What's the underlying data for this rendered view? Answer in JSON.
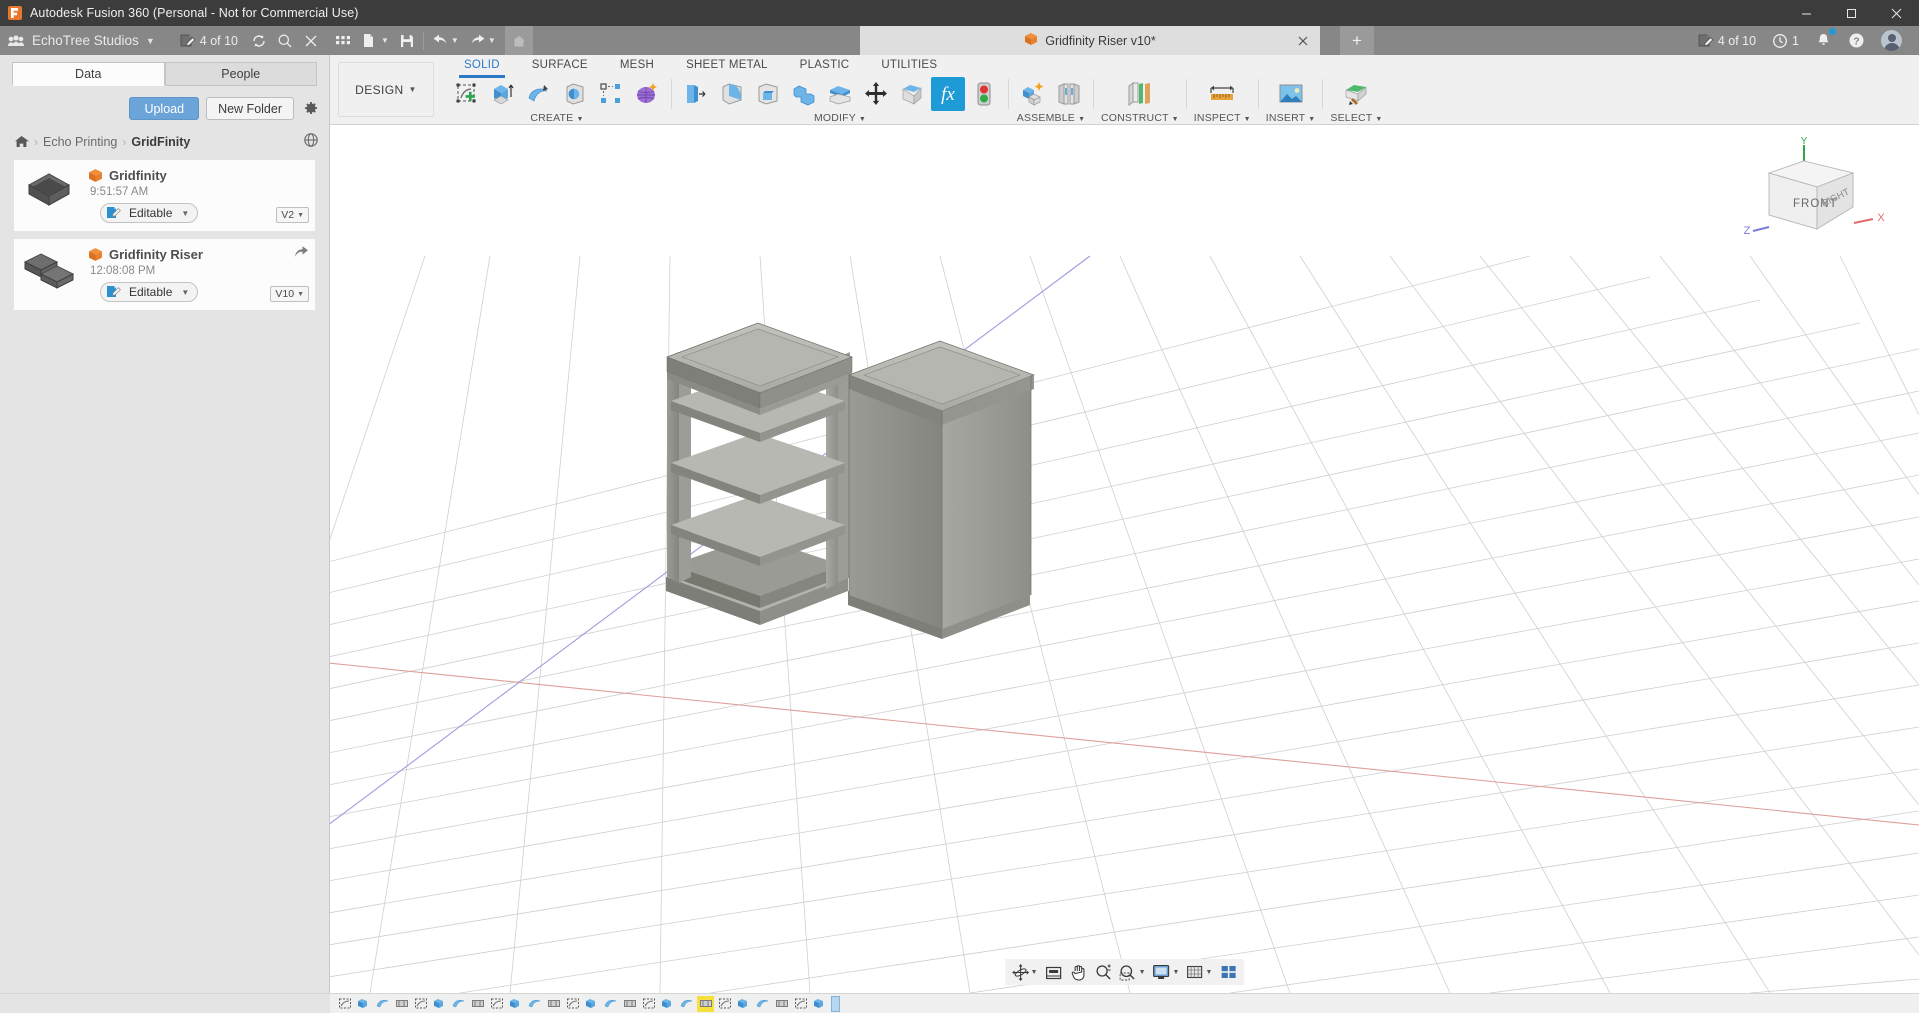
{
  "titlebar": {
    "app_title": "Autodesk Fusion 360 (Personal - Not for Commercial Use)",
    "logo_icon": "fusion-logo-icon",
    "minimize_icon": "minimize-icon",
    "maximize_icon": "maximize-icon",
    "close_icon": "close-icon"
  },
  "appbar": {
    "apps_grid_icon": "apps-grid-icon",
    "team_name": "EchoTree Studios",
    "team_caret_icon": "chevron-down-icon",
    "jobs_icon": "jobs-status-icon",
    "jobs_label": "4 of 10",
    "refresh_icon": "refresh-icon",
    "search_icon": "search-icon",
    "close_panel_icon": "close-icon",
    "quick_access": [
      {
        "name": "grid-menu-icon",
        "label": ""
      },
      {
        "name": "new-document-icon",
        "label": ""
      },
      {
        "name": "save-icon",
        "label": ""
      },
      {
        "name": "undo-icon",
        "label": ""
      },
      {
        "name": "redo-icon",
        "label": ""
      },
      {
        "name": "home-icon",
        "label": ""
      }
    ],
    "document_tab": {
      "cube_icon": "orange-cube-icon",
      "label": "Gridfinity Riser v10*",
      "close_icon": "close-icon"
    },
    "new_tab_icon": "plus-icon",
    "right": {
      "jobs_icon": "jobs-status-icon",
      "jobs_label": "4 of 10",
      "clock_icon": "clock-icon",
      "clock_label": "1",
      "bell_icon": "notification-bell-icon",
      "help_icon": "help-icon",
      "avatar_icon": "user-avatar"
    }
  },
  "data_panel": {
    "tabs": [
      {
        "label": "Data",
        "active": true
      },
      {
        "label": "People",
        "active": false
      }
    ],
    "upload_label": "Upload",
    "new_folder_label": "New Folder",
    "settings_icon": "gear-icon",
    "breadcrumb": {
      "home_icon": "home-icon",
      "items": [
        "Echo Printing",
        "GridFinity"
      ],
      "separator": "›",
      "globe_icon": "globe-icon"
    },
    "files": [
      {
        "name": "Gridfinity",
        "time": "9:51:57 AM",
        "cube_icon": "orange-cube-icon",
        "status_label": "Editable",
        "status_icon": "editable-icon",
        "status_caret": "chevron-down-icon",
        "version": "V2",
        "version_caret": "chevron-down-icon",
        "thumbnail": "gridfinity-bin-thumbnail"
      },
      {
        "name": "Gridfinity Riser",
        "time": "12:08:08 PM",
        "cube_icon": "orange-cube-icon",
        "status_label": "Editable",
        "status_icon": "editable-icon",
        "status_caret": "chevron-down-icon",
        "version": "V10",
        "version_caret": "chevron-down-icon",
        "thumbnail": "gridfinity-riser-thumbnail",
        "share_icon": "share-icon"
      }
    ]
  },
  "ribbon": {
    "workspace_label": "DESIGN",
    "workspace_caret": "chevron-down-icon",
    "tabs": [
      {
        "label": "SOLID",
        "active": true
      },
      {
        "label": "SURFACE",
        "active": false
      },
      {
        "label": "MESH",
        "active": false
      },
      {
        "label": "SHEET METAL",
        "active": false
      },
      {
        "label": "PLASTIC",
        "active": false
      },
      {
        "label": "UTILITIES",
        "active": false
      }
    ],
    "panels": [
      {
        "title": "CREATE",
        "caret": "chevron-down-icon",
        "tools": [
          "create-sketch-icon",
          "extrude-icon",
          "revolve-icon",
          "sphere-icon",
          "pattern-icon",
          "form-icon"
        ]
      },
      {
        "title": "MODIFY",
        "caret": "chevron-down-icon",
        "tools": [
          "press-pull-icon",
          "fillet-icon",
          "shell-icon",
          "combine-icon",
          "split-face-icon",
          "move-copy-icon",
          "align-icon",
          "change-parameters-icon",
          "compute-all-icon"
        ],
        "selected_tool": "change-parameters-icon"
      },
      {
        "title": "ASSEMBLE",
        "caret": "chevron-down-icon",
        "tools": [
          "new-component-icon",
          "joint-icon"
        ]
      },
      {
        "title": "CONSTRUCT",
        "caret": "chevron-down-icon",
        "tools": [
          "offset-plane-icon"
        ]
      },
      {
        "title": "INSPECT",
        "caret": "chevron-down-icon",
        "tools": [
          "measure-icon"
        ]
      },
      {
        "title": "INSERT",
        "caret": "chevron-down-icon",
        "tools": [
          "insert-image-icon"
        ]
      },
      {
        "title": "SELECT",
        "caret": "chevron-down-icon",
        "tools": [
          "select-icon"
        ]
      }
    ]
  },
  "viewport": {
    "viewcube": {
      "front_label": "FRONT",
      "right_label": "RIGHT",
      "axis_x": "X",
      "axis_y": "Y",
      "axis_z": "Z"
    },
    "grid_color": "#c9c9c9",
    "model_color": "#8e8f89",
    "axis_x_color": "#e8958c",
    "axis_z_color": "#8f8fe0",
    "models": [
      "gridfinity-riser-open",
      "gridfinity-riser-closed"
    ]
  },
  "navbar": {
    "buttons": [
      {
        "name": "orbit-icon",
        "caret": true
      },
      {
        "name": "look-at-icon",
        "caret": false
      },
      {
        "name": "pan-icon",
        "caret": false
      },
      {
        "name": "zoom-icon",
        "caret": false
      },
      {
        "name": "fit-icon",
        "caret": true
      },
      {
        "name": "display-settings-icon",
        "caret": true
      },
      {
        "name": "grid-snaps-icon",
        "caret": true
      },
      {
        "name": "viewport-layout-icon",
        "caret": false
      }
    ]
  },
  "timeline": {
    "node_count": 26,
    "selected_index": 19,
    "playhead_icon": "timeline-playhead"
  }
}
